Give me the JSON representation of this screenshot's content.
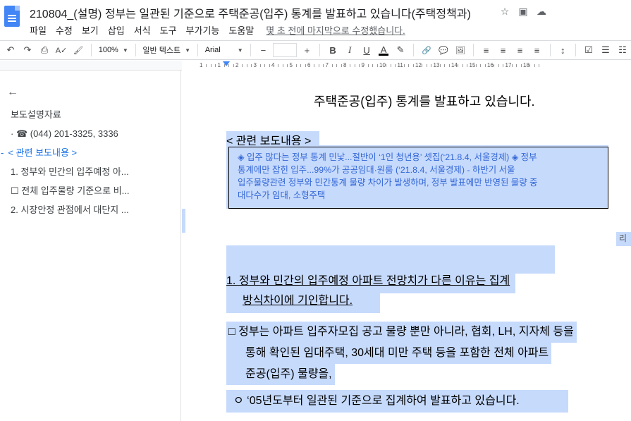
{
  "app": {
    "doc_title": "210804_(설명) 정부는 일관된 기준으로 주택준공(입주) 통계를 발표하고 있습니다(주택정책과)",
    "title_icons": [
      "star-icon",
      "move-to-folder-icon",
      "cloud-status-icon"
    ],
    "menu": [
      "파일",
      "수정",
      "보기",
      "삽입",
      "서식",
      "도구",
      "부가기능",
      "도움말"
    ],
    "last_edit": "몇 초 전에 마지막으로 수정했습니다."
  },
  "toolbar": {
    "undo": "↶",
    "redo": "↷",
    "print": "⎙",
    "spellcheck": "A✓",
    "paint_format": "🖌",
    "zoom": "100%",
    "style": "일반 텍스트",
    "font": "Arial",
    "size_minus": "−",
    "size_plus": "+",
    "bold": "B",
    "italic": "I",
    "underline": "U",
    "text_color": "A",
    "highlight": "✎",
    "link": "🔗",
    "comment": "💬",
    "image": "🖼",
    "align_left": "≡",
    "align_center": "≡",
    "align_right": "≡",
    "justify": "≡",
    "line_spacing": "↕",
    "checklist": "☑",
    "bullets": "☰",
    "numbered": "☷"
  },
  "ruler": {
    "numbers": [
      "1",
      "1",
      "2",
      "3",
      "4",
      "5",
      "6",
      "7",
      "8",
      "9",
      "10",
      "11",
      "12",
      "13",
      "14",
      "15",
      "16",
      "17",
      "18"
    ]
  },
  "sidebar": {
    "back_icon": "←",
    "items": [
      {
        "text": "보도설명자료"
      },
      {
        "text": "· ☎ (044) 201-3325, 3336"
      },
      {
        "text": "< 관련 보도내용 >"
      },
      {
        "text": "1. 정부와 민간의 입주예정 아..."
      },
      {
        "text": "☐ 전체 입주물량 기준으로 비..."
      },
      {
        "text": "2. 시장안정 관점에서 대단지 ..."
      }
    ]
  },
  "document": {
    "title": "주택준공(입주) 통계를 발표하고 있습니다.",
    "related_heading": "< 관련 보도내용 >",
    "related_box": [
      "◈ 입주 많다는 정부 통계 민낯...절반이 ‘1인 청년용’ 셋집(‘21.8.4, 서울경제) ◈ 정부",
      "통계에만 잡힌 입주...99%가 공공임대·원룸 (‘21.8.4, 서울경제) - 하반기 서울",
      "입주물량관련 정부와 민간통계 물량 차이가 발생하며, 정부 발표에만 반영된 물량 중",
      "대다수가 임대, 소형주택"
    ],
    "right_edge_text": "리",
    "heading1_line1": "1. 정부와 민간의 입주예정 아파트 전망치가 다른 이유는 집계",
    "heading1_line2": "방식차이에 기인합니다.",
    "para_line1": "□ 정부는 아파트 입주자모집 공고 물량 뿐만 아니라, 협회, LH, 지자체 등을",
    "para_line2": "통해 확인된 임대주택, 30세대 미만 주택 등을  포함한 전체 아파트",
    "para_line3": "준공(입주) 물량을,",
    "sub_para": "ㅇ ‘05년도부터 일관된 기준으로 집계하여 발표하고 있습니다."
  },
  "colors": {
    "selection": "#c6dafc",
    "link_blue": "#3367d6",
    "docs_blue": "#4285f4"
  }
}
